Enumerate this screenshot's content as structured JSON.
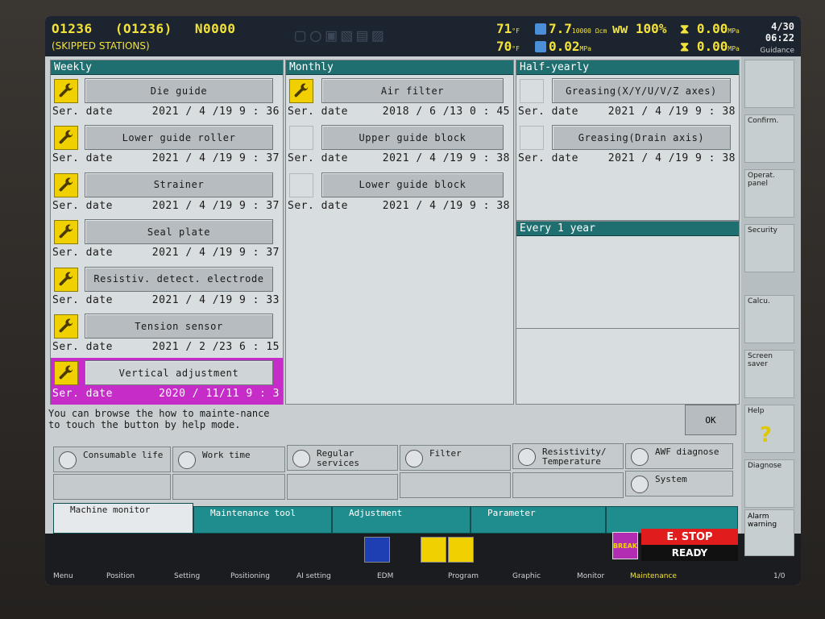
{
  "header": {
    "program_main": "O1236",
    "program_sub": "(O1236)",
    "sequence": "N0000",
    "skipped": "(SKIPPED STATIONS)",
    "temp": "71",
    "temp_unit": "°F",
    "temp2": "70",
    "temp2_unit": "°F",
    "resistivity": "7.7",
    "resistivity_unit": "10000 Ωcm",
    "pressure_small": "0.02",
    "pressure_small_unit": "MPa",
    "wire_pct": "100",
    "wire_unit": "%",
    "press1": "0.00",
    "press1_unit": "MPa",
    "press2": "0.00",
    "press2_unit": "MPa",
    "date": "4/30",
    "time": "06:22",
    "guidance": "Guidance"
  },
  "side_menu": {
    "confirm": "Confirm.",
    "operat_panel": "Operat. panel",
    "security": "Security",
    "calcu": "Calcu.",
    "screen_saver": "Screen saver",
    "help": "Help",
    "help_symbol": "?",
    "diagnose": "Diagnose",
    "alarm_warning": "Alarm warning"
  },
  "weekly": {
    "title": "Weekly",
    "items": [
      {
        "label": "Die guide",
        "ser": "Ser. date",
        "date": "2021 / 4 /19  9 : 36"
      },
      {
        "label": "Lower guide roller",
        "ser": "Ser. date",
        "date": "2021 / 4 /19  9 : 37"
      },
      {
        "label": "Strainer",
        "ser": "Ser. date",
        "date": "2021 / 4 /19  9 : 37"
      },
      {
        "label": "Seal plate",
        "ser": "Ser. date",
        "date": "2021 / 4 /19  9 : 37"
      },
      {
        "label": "Resistiv. detect. electrode",
        "ser": "Ser. date",
        "date": "2021 / 4 /19  9 : 33"
      },
      {
        "label": "Tension sensor",
        "ser": "Ser. date",
        "date": "2021 / 2 /23  6 : 15"
      },
      {
        "label": "Vertical adjustment",
        "ser": "Ser. date",
        "date": "2020 / 11/11  9 : 3"
      }
    ]
  },
  "monthly": {
    "title": "Monthly",
    "items": [
      {
        "label": "Air filter",
        "ser": "Ser. date",
        "date": "2018 / 6 /13  0 : 45"
      },
      {
        "label": "Upper guide block",
        "ser": "Ser. date",
        "date": "2021 / 4 /19  9 : 38"
      },
      {
        "label": "Lower guide block",
        "ser": "Ser. date",
        "date": "2021 / 4 /19  9 : 38"
      }
    ]
  },
  "half_yearly": {
    "title": "Half-yearly",
    "items": [
      {
        "label": "Greasing(X/Y/U/V/Z axes)",
        "ser": "Ser. date",
        "date": "2021 / 4 /19  9 : 38"
      },
      {
        "label": "Greasing(Drain axis)",
        "ser": "Ser. date",
        "date": "2021 / 4 /19  9 : 38"
      }
    ]
  },
  "every_year": {
    "title": "Every 1 year"
  },
  "help_text": "You can browse the how to mainte-nance to touch the button by help mode.",
  "ok_label": "OK",
  "tools": {
    "consumable": "Consumable life",
    "work_time": "Work time",
    "regular": "Regular services",
    "filter": "Filter",
    "resistivity": "Resistivity/ Temperature",
    "awf": "AWF diagnose",
    "system": "System"
  },
  "tabs": {
    "machine_monitor": "Machine monitor",
    "maintenance_tool": "Maintenance tool",
    "adjustment": "Adjustment",
    "parameter": "Parameter"
  },
  "status": {
    "break": "BREAK",
    "estop": "E. STOP",
    "ready": "READY"
  },
  "fkeys": {
    "menu": "Menu",
    "position": "Position",
    "setting": "Setting",
    "positioning": "Positioning",
    "ai_setting": "AI setting",
    "edm": "EDM",
    "program": "Program",
    "graphic": "Graphic",
    "monitor": "Monitor",
    "maintenance": "Maintenance",
    "page": "1/0"
  },
  "colors": {
    "panel_title": "#1f6f70",
    "highlight": "#c52cc8",
    "wrench": "#f0d000",
    "status_yellow": "#f2e23a",
    "estop": "#e11c1c"
  }
}
